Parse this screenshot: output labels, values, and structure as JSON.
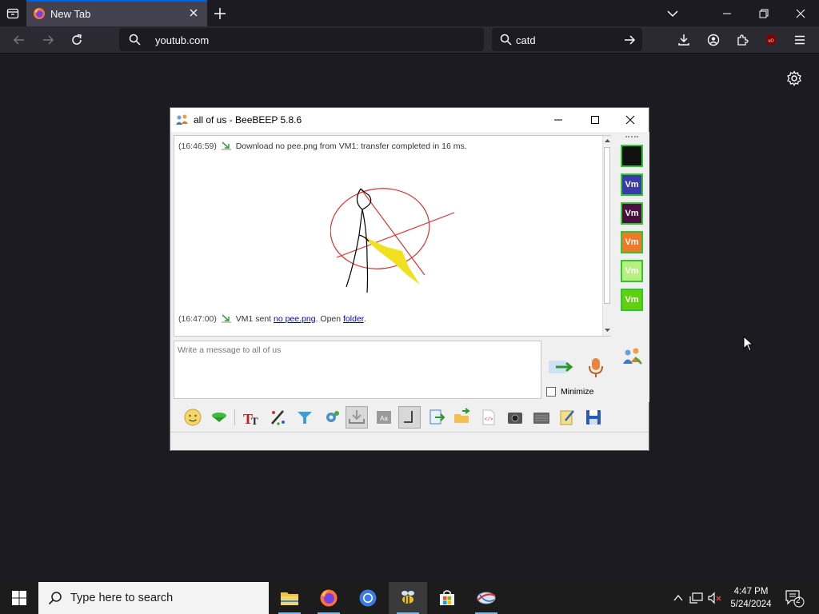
{
  "browser": {
    "tab": {
      "title": "New Tab"
    },
    "url": "youtub.com",
    "search_text": "catd",
    "ublock_badge": "uO"
  },
  "beebeep": {
    "window_title": "all of us - BeeBEEP 5.8.6",
    "messages": {
      "m1": {
        "time": "(16:46:59)",
        "text": "Download no pee.png from VM1: transfer completed in 16 ms."
      },
      "m2": {
        "time": "(16:47:00)",
        "prefix": "VM1 sent ",
        "file_link": "no pee.png",
        "middle": ". Open ",
        "folder_link": "folder",
        "suffix": "."
      }
    },
    "input_placeholder": "Write a message to all of us",
    "minimize_label": "Minimize",
    "users": [
      {
        "label": "",
        "color": "#111111"
      },
      {
        "label": "Vm",
        "color": "#3a3aa8"
      },
      {
        "label": "Vm",
        "color": "#4a1040"
      },
      {
        "label": "Vm",
        "color": "#f07828"
      },
      {
        "label": "Vm",
        "color": "#b8f080"
      },
      {
        "label": "Vm",
        "color": "#60d010"
      }
    ]
  },
  "taskbar": {
    "search_placeholder": "Type here to search",
    "time": "4:47 PM",
    "date": "5/24/2024",
    "notifications": "2"
  }
}
